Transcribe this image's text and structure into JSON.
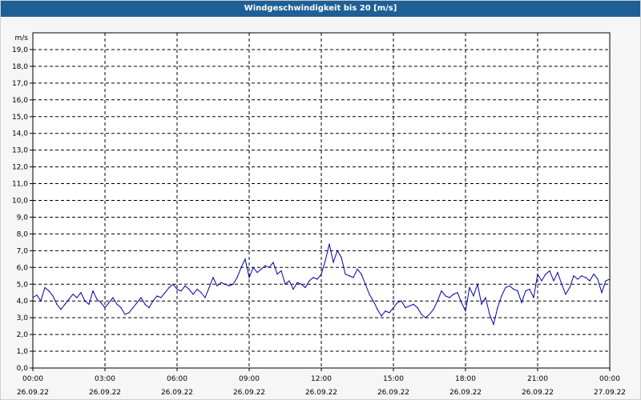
{
  "window": {
    "title": "Windgeschwindigkeit bis 20 [m/s]"
  },
  "chart_data": {
    "type": "line",
    "title": "Windgeschwindigkeit bis 20 [m/s]",
    "ylabel": "m/s",
    "xlabel": "",
    "ylim": [
      0,
      20
    ],
    "y_ticks": [
      "0,0",
      "1,0",
      "2,0",
      "3,0",
      "4,0",
      "5,0",
      "6,0",
      "7,0",
      "8,0",
      "9,0",
      "10,0",
      "11,0",
      "12,0",
      "13,0",
      "14,0",
      "15,0",
      "16,0",
      "17,0",
      "18,0",
      "19,0"
    ],
    "x_ticks": [
      {
        "time": "00:00",
        "date": "26.09.22"
      },
      {
        "time": "03:00",
        "date": "26.09.22"
      },
      {
        "time": "06:00",
        "date": "26.09.22"
      },
      {
        "time": "09:00",
        "date": "26.09.22"
      },
      {
        "time": "12:00",
        "date": "26.09.22"
      },
      {
        "time": "15:00",
        "date": "26.09.22"
      },
      {
        "time": "18:00",
        "date": "26.09.22"
      },
      {
        "time": "21:00",
        "date": "26.09.22"
      },
      {
        "time": "00:00",
        "date": "27.09.22"
      }
    ],
    "grid": true,
    "line_color": "#0000aa",
    "x": [
      "26.09.22 00:00",
      "26.09.22 00:10",
      "26.09.22 00:20",
      "26.09.22 00:30",
      "26.09.22 00:40",
      "26.09.22 00:50",
      "26.09.22 01:00",
      "26.09.22 01:10",
      "26.09.22 01:20",
      "26.09.22 01:30",
      "26.09.22 01:40",
      "26.09.22 01:50",
      "26.09.22 02:00",
      "26.09.22 02:10",
      "26.09.22 02:20",
      "26.09.22 02:30",
      "26.09.22 02:40",
      "26.09.22 02:50",
      "26.09.22 03:00",
      "26.09.22 03:10",
      "26.09.22 03:20",
      "26.09.22 03:30",
      "26.09.22 03:40",
      "26.09.22 03:50",
      "26.09.22 04:00",
      "26.09.22 04:10",
      "26.09.22 04:20",
      "26.09.22 04:30",
      "26.09.22 04:40",
      "26.09.22 04:50",
      "26.09.22 05:00",
      "26.09.22 05:10",
      "26.09.22 05:20",
      "26.09.22 05:30",
      "26.09.22 05:40",
      "26.09.22 05:50",
      "26.09.22 06:00",
      "26.09.22 06:10",
      "26.09.22 06:20",
      "26.09.22 06:30",
      "26.09.22 06:40",
      "26.09.22 06:50",
      "26.09.22 07:00",
      "26.09.22 07:10",
      "26.09.22 07:20",
      "26.09.22 07:30",
      "26.09.22 07:40",
      "26.09.22 07:50",
      "26.09.22 08:00",
      "26.09.22 08:10",
      "26.09.22 08:20",
      "26.09.22 08:30",
      "26.09.22 08:40",
      "26.09.22 08:50",
      "26.09.22 09:00",
      "26.09.22 09:10",
      "26.09.22 09:20",
      "26.09.22 09:30",
      "26.09.22 09:40",
      "26.09.22 09:50",
      "26.09.22 10:00",
      "26.09.22 10:10",
      "26.09.22 10:20",
      "26.09.22 10:30",
      "26.09.22 10:40",
      "26.09.22 10:50",
      "26.09.22 11:00",
      "26.09.22 11:10",
      "26.09.22 11:20",
      "26.09.22 11:30",
      "26.09.22 11:40",
      "26.09.22 11:50",
      "26.09.22 12:00",
      "26.09.22 12:10",
      "26.09.22 12:20",
      "26.09.22 12:30",
      "26.09.22 12:40",
      "26.09.22 12:50",
      "26.09.22 13:00",
      "26.09.22 13:10",
      "26.09.22 13:20",
      "26.09.22 13:30",
      "26.09.22 13:40",
      "26.09.22 13:50",
      "26.09.22 14:00",
      "26.09.22 14:10",
      "26.09.22 14:20",
      "26.09.22 14:30",
      "26.09.22 14:40",
      "26.09.22 14:50",
      "26.09.22 15:00",
      "26.09.22 15:10",
      "26.09.22 15:20",
      "26.09.22 15:30",
      "26.09.22 15:40",
      "26.09.22 15:50",
      "26.09.22 16:00",
      "26.09.22 16:10",
      "26.09.22 16:20",
      "26.09.22 16:30",
      "26.09.22 16:40",
      "26.09.22 16:50",
      "26.09.22 17:00",
      "26.09.22 17:10",
      "26.09.22 17:20",
      "26.09.22 17:30",
      "26.09.22 17:40",
      "26.09.22 17:50",
      "26.09.22 18:00",
      "26.09.22 18:10",
      "26.09.22 18:20",
      "26.09.22 18:30",
      "26.09.22 18:40",
      "26.09.22 18:50",
      "26.09.22 19:00",
      "26.09.22 19:10",
      "26.09.22 19:20",
      "26.09.22 19:30",
      "26.09.22 19:40",
      "26.09.22 19:50",
      "26.09.22 20:00",
      "26.09.22 20:10",
      "26.09.22 20:20",
      "26.09.22 20:30",
      "26.09.22 20:40",
      "26.09.22 20:50",
      "26.09.22 21:00",
      "26.09.22 21:10",
      "26.09.22 21:20",
      "26.09.22 21:30",
      "26.09.22 21:40",
      "26.09.22 21:50",
      "26.09.22 22:00",
      "26.09.22 22:10",
      "26.09.22 22:20",
      "26.09.22 22:30",
      "26.09.22 22:40",
      "26.09.22 22:50",
      "26.09.22 23:00",
      "26.09.22 23:10",
      "26.09.22 23:20",
      "26.09.22 23:30",
      "26.09.22 23:40",
      "26.09.22 23:50",
      "27.09.22 00:00"
    ],
    "values": [
      4.2,
      4.35,
      4.0,
      4.8,
      4.6,
      4.3,
      3.8,
      3.5,
      3.8,
      4.1,
      4.4,
      4.2,
      4.5,
      4.0,
      3.8,
      4.6,
      4.1,
      3.9,
      3.6,
      3.9,
      4.2,
      3.8,
      3.6,
      3.2,
      3.3,
      3.6,
      3.9,
      4.2,
      3.8,
      3.6,
      4.0,
      4.3,
      4.2,
      4.5,
      4.8,
      5.0,
      4.7,
      4.6,
      4.9,
      4.7,
      4.4,
      4.7,
      4.5,
      4.2,
      4.8,
      5.4,
      4.9,
      5.1,
      5.0,
      4.9,
      5.0,
      5.4,
      6.0,
      6.5,
      5.4,
      6.0,
      5.7,
      5.9,
      6.1,
      6.0,
      6.3,
      5.6,
      5.8,
      5.0,
      5.2,
      4.7,
      5.1,
      5.0,
      4.8,
      5.2,
      5.4,
      5.3,
      5.6,
      6.4,
      7.4,
      6.3,
      7.0,
      6.6,
      5.6,
      5.5,
      5.4,
      5.9,
      5.6,
      5.0,
      4.4,
      4.0,
      3.5,
      3.1,
      3.4,
      3.3,
      3.6,
      3.9,
      4.0,
      3.6,
      3.7,
      3.8,
      3.6,
      3.2,
      3.0,
      3.2,
      3.5,
      4.0,
      4.6,
      4.3,
      4.2,
      4.4,
      4.5,
      3.9,
      3.4,
      4.8,
      4.3,
      5.0,
      3.8,
      4.2,
      3.2,
      2.6,
      3.6,
      4.3,
      4.8,
      4.9,
      4.7,
      4.6,
      3.9,
      4.6,
      4.7,
      4.2,
      5.6,
      5.2,
      5.6,
      5.8,
      5.2,
      5.7,
      5.0,
      4.4,
      4.8,
      5.5,
      5.3,
      5.5,
      5.4,
      5.2,
      5.6,
      5.3,
      4.5,
      5.2,
      5.3
    ]
  }
}
